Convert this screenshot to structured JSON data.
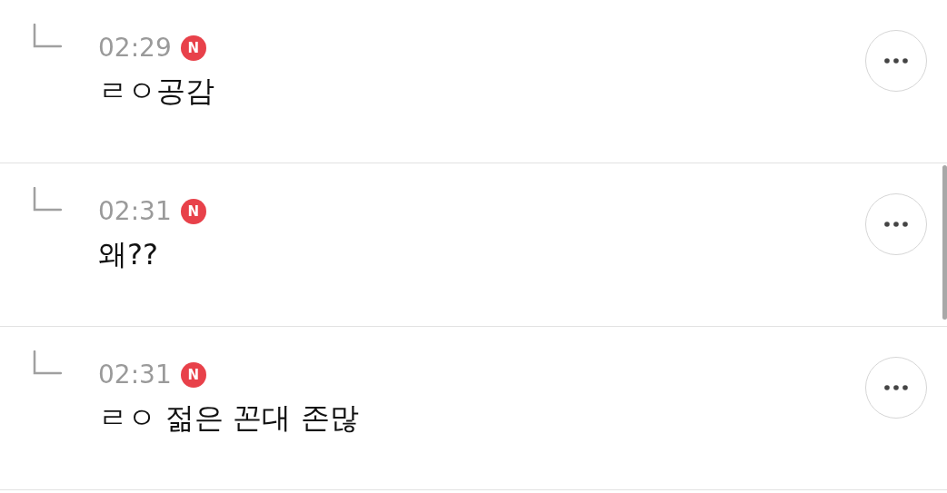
{
  "replies": [
    {
      "time": "02:29",
      "badge": "N",
      "text": "ㄹㅇ공감"
    },
    {
      "time": "02:31",
      "badge": "N",
      "text": "왜??"
    },
    {
      "time": "02:31",
      "badge": "N",
      "text": "ㄹㅇ 젊은 꼰대 존많"
    }
  ]
}
